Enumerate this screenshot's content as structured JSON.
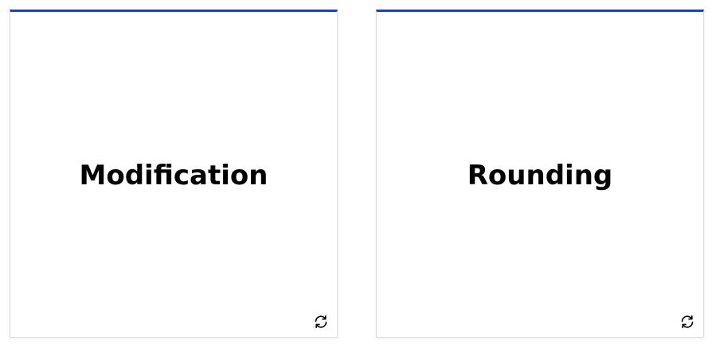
{
  "cards": [
    {
      "term": "Modification",
      "flip_icon": "flip-icon"
    },
    {
      "term": "Rounding",
      "flip_icon": "flip-icon"
    }
  ],
  "colors": {
    "accent": "#1a3fd1",
    "text": "#000000",
    "border": "#dcdcdc"
  }
}
